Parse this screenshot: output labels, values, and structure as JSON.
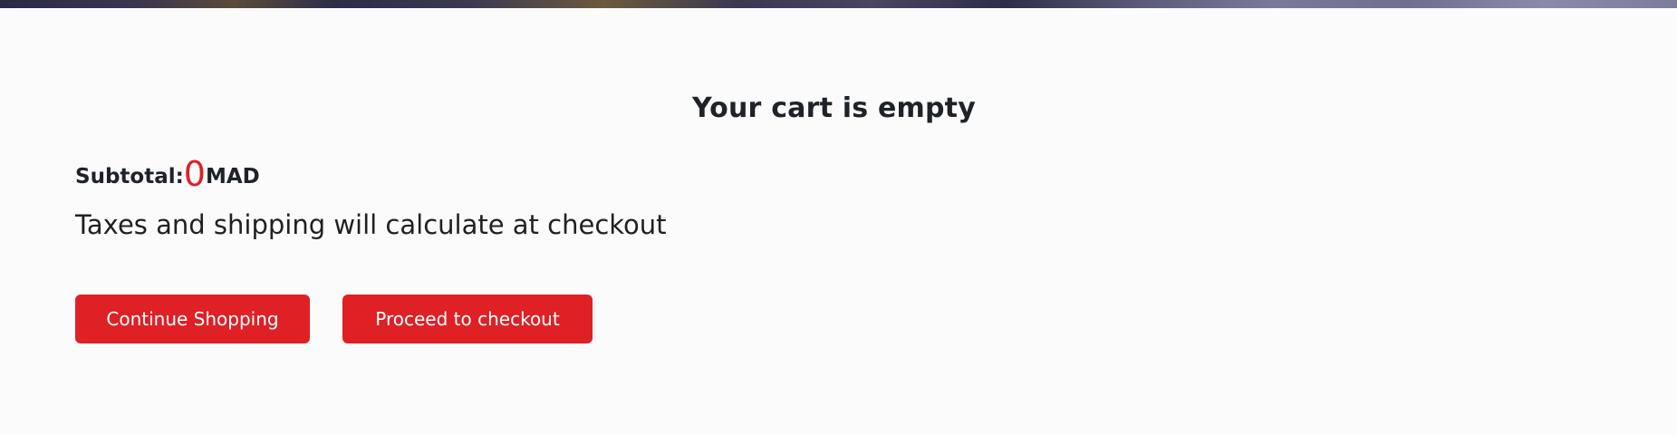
{
  "cart": {
    "title": "Your cart is empty",
    "subtotal_label": "Subtotal:",
    "subtotal_value": "0",
    "currency": "MAD",
    "tax_note": "Taxes and shipping will calculate at checkout"
  },
  "actions": {
    "continue_label": "Continue Shopping",
    "checkout_label": "Proceed to checkout"
  },
  "colors": {
    "accent": "#df2025",
    "text": "#212121",
    "background": "#fbfbfb"
  }
}
